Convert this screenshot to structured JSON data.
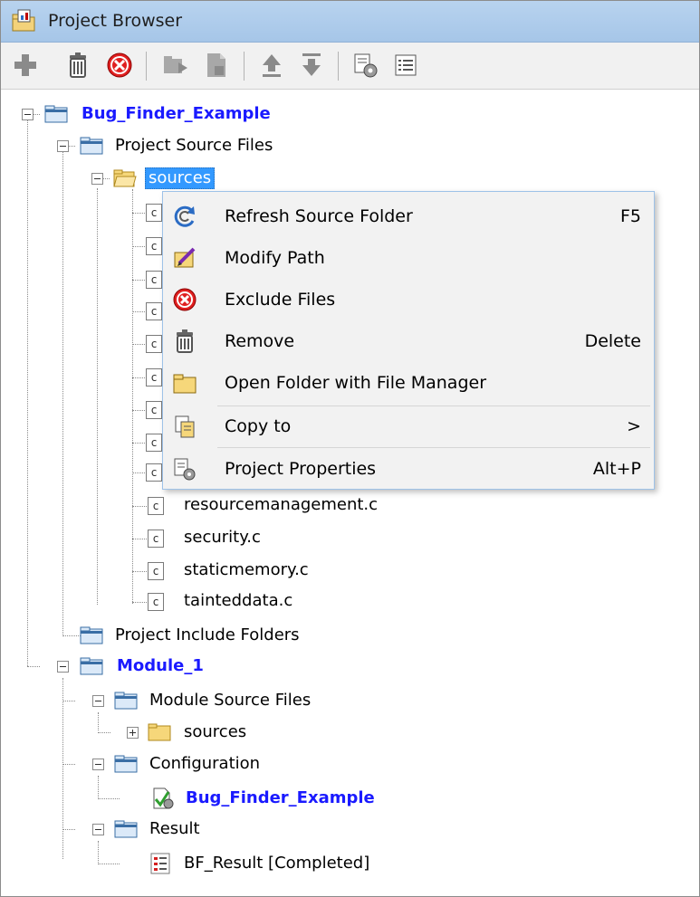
{
  "window": {
    "title": "Project Browser"
  },
  "tree": {
    "project": {
      "label": "Bug_Finder_Example",
      "source_files": {
        "label": "Project Source Files",
        "sources_folder": "sources",
        "visible_files": [
          "resourcemanagement.c",
          "security.c",
          "staticmemory.c",
          "tainteddata.c"
        ],
        "file_icon_glyph": "c"
      },
      "include_folders": "Project Include Folders"
    },
    "module": {
      "label": "Module_1",
      "source_files": "Module Source Files",
      "sources_folder": "sources",
      "configuration": "Configuration",
      "configuration_item": "Bug_Finder_Example",
      "result": "Result",
      "result_item": "BF_Result [Completed]"
    }
  },
  "context_menu": {
    "items": [
      {
        "label": "Refresh Source Folder",
        "shortcut": "F5",
        "icon": "refresh-icon"
      },
      {
        "label": "Modify Path",
        "shortcut": "",
        "icon": "edit-path-icon"
      },
      {
        "label": "Exclude Files",
        "shortcut": "",
        "icon": "exclude-icon"
      },
      {
        "label": "Remove",
        "shortcut": "Delete",
        "icon": "trash-icon"
      },
      {
        "label": "Open Folder with File Manager",
        "shortcut": "",
        "icon": "folder-icon"
      },
      {
        "label": "Copy to",
        "shortcut": ">",
        "icon": "copy-icon"
      },
      {
        "label": "Project Properties",
        "shortcut": "Alt+P",
        "icon": "project-properties-icon"
      }
    ]
  },
  "colors": {
    "title_bar": "#b8d3ef",
    "selection": "#3399ff",
    "bold_node": "#1a1aff",
    "menu_border": "#9ec2e8"
  }
}
